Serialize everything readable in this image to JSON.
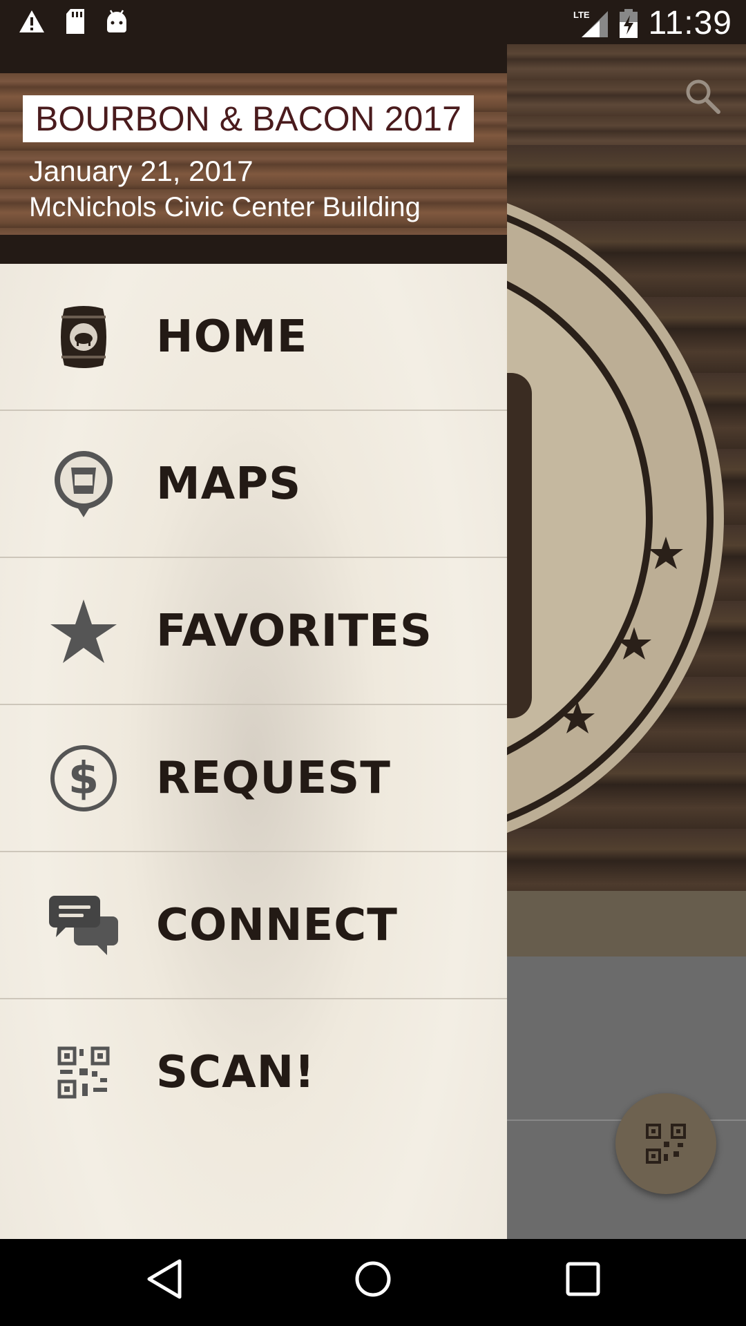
{
  "status_bar": {
    "time": "11:39",
    "left_icons": [
      "warning-icon",
      "sd-card-icon",
      "android-icon"
    ],
    "right_icons": [
      "lte-signal-icon",
      "battery-icon"
    ],
    "network_label": "LTE"
  },
  "drawer": {
    "event_title": "BOURBON & BACON 2017",
    "event_date": "January 21, 2017",
    "event_venue": "McNichols Civic Center Building",
    "items": [
      {
        "label": "HOME",
        "icon": "barrel-icon"
      },
      {
        "label": "MAPS",
        "icon": "map-pin-icon"
      },
      {
        "label": "FAVORITES",
        "icon": "star-icon"
      },
      {
        "label": "REQUEST",
        "icon": "dollar-icon"
      },
      {
        "label": "CONNECT",
        "icon": "chat-icon"
      },
      {
        "label": "SCAN!",
        "icon": "qr-code-icon"
      }
    ]
  },
  "background": {
    "search_icon": "search-icon",
    "fab_icon": "qr-code-icon"
  },
  "colors": {
    "header_bg": "#231a15",
    "title_text": "#4a1b1d",
    "menu_text": "#231a15",
    "drawer_bg": "#f3eee4"
  },
  "nav_bar": {
    "icons": [
      "back-icon",
      "home-icon",
      "recents-icon"
    ]
  }
}
